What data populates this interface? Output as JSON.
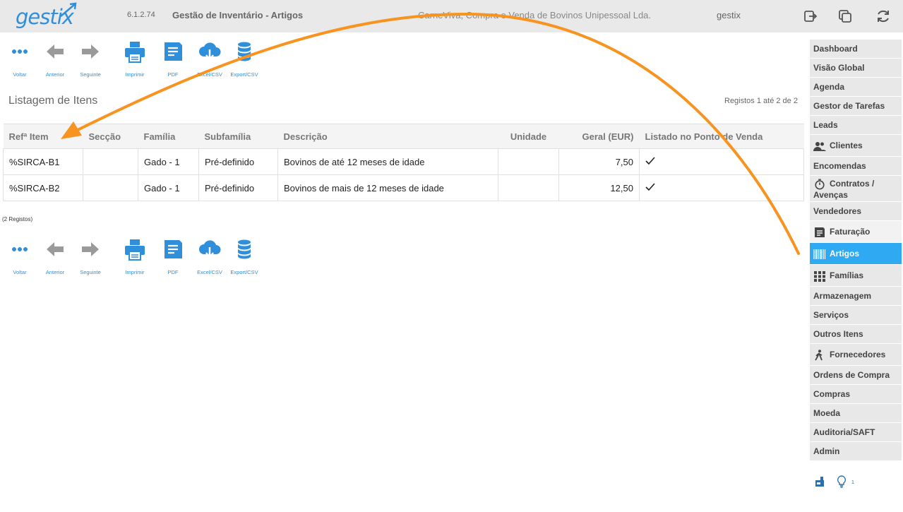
{
  "header": {
    "logo": "gestix",
    "version": "6.1.2.74",
    "module_title": "Gestão de Inventário - Artigos",
    "company": "CarneViva, Compra e Venda de Bovinos Unipessoal Lda.",
    "user": "gestix",
    "icons": [
      "logout-icon",
      "copy-window-icon",
      "refresh-icon"
    ]
  },
  "toolbar": {
    "voltar": "Voltar",
    "anterior": "Anterior",
    "seguinte": "Seguinte",
    "imprimir": "Imprimir",
    "pdf": "PDF",
    "excel": "Excel/CSV",
    "export": "Export/CSV"
  },
  "listing": {
    "title": "Listagem de Itens",
    "range": "Registos 1 até 2 de 2",
    "count": "(2 Registos)",
    "columns": [
      "Refª Item",
      "Secção",
      "Família",
      "Subfamília",
      "Descrição",
      "Unidade",
      "Geral (EUR)",
      "Listado no Ponto de Venda"
    ],
    "rows": [
      {
        "ref": "%SIRCA-B1",
        "seccao": "",
        "familia": "Gado - 1",
        "subfamilia": "Pré-definido",
        "descricao": "Bovinos de até 12 meses de idade",
        "unidade": "",
        "geral": "7,50",
        "listado": true
      },
      {
        "ref": "%SIRCA-B2",
        "seccao": "",
        "familia": "Gado - 1",
        "subfamilia": "Pré-definido",
        "descricao": "Bovinos de mais de 12 meses de idade",
        "unidade": "",
        "geral": "12,50",
        "listado": true
      }
    ]
  },
  "sidebar": {
    "items": [
      {
        "label": "Dashboard"
      },
      {
        "label": "Visão Global"
      },
      {
        "label": "Agenda"
      },
      {
        "label": "Gestor de Tarefas"
      },
      {
        "label": "Leads"
      },
      {
        "label": "Clientes",
        "icon": "users-icon"
      },
      {
        "label": "Encomendas"
      },
      {
        "label": "Contratos / Avenças",
        "icon": "stopwatch-icon"
      },
      {
        "label": "Vendedores"
      },
      {
        "label": "Faturação",
        "icon": "document-icon"
      },
      {
        "label": "Artigos",
        "icon": "barcode-icon",
        "active": true
      },
      {
        "label": "Famílias",
        "icon": "grid-icon"
      },
      {
        "label": "Armazenagem"
      },
      {
        "label": "Serviços"
      },
      {
        "label": "Outros Itens"
      },
      {
        "label": "Fornecedores",
        "icon": "walking-person-icon"
      },
      {
        "label": "Ordens de Compra"
      },
      {
        "label": "Compras"
      },
      {
        "label": "Moeda"
      },
      {
        "label": "Auditoria/SAFT"
      },
      {
        "label": "Admin"
      }
    ],
    "bottom_badge": "1"
  },
  "colors": {
    "accent": "#2faaf2",
    "brand": "#2f8fdb",
    "annotation_arrow": "#f7931e"
  }
}
